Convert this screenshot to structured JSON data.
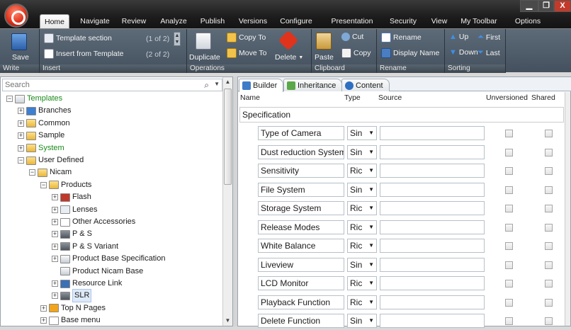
{
  "window": {
    "minimize": "▁",
    "restore": "❐",
    "close": "X"
  },
  "tabs": [
    "Home",
    "Navigate",
    "Review",
    "Analyze",
    "Publish",
    "Versions",
    "Configure",
    "Presentation",
    "Security",
    "View",
    "My Toolbar",
    "Options"
  ],
  "ribbon": {
    "write": {
      "label": "Write",
      "save": "Save"
    },
    "insert": {
      "label": "Insert",
      "template_section": "Template section",
      "template_section_count": "(1 of 2)",
      "insert_from_template": "Insert from Template",
      "insert_from_template_count": "(2 of 2)"
    },
    "operations": {
      "label": "Operations",
      "duplicate": "Duplicate",
      "copy_to": "Copy To",
      "move_to": "Move To",
      "delete": "Delete"
    },
    "clipboard": {
      "label": "Clipboard",
      "paste": "Paste",
      "cut": "Cut",
      "copy": "Copy"
    },
    "rename": {
      "label": "Rename",
      "rename": "Rename",
      "display_name": "Display Name"
    },
    "sorting": {
      "label": "Sorting",
      "up": "Up",
      "down": "Down",
      "first": "First",
      "last": "Last"
    }
  },
  "search": {
    "placeholder": "Search"
  },
  "tree": [
    {
      "label": "Templates",
      "level": 0,
      "exp": "−",
      "icon": "template-icon",
      "green": true
    },
    {
      "label": "Branches",
      "level": 1,
      "exp": "+",
      "icon": "branches-icon"
    },
    {
      "label": "Common",
      "level": 1,
      "exp": "+",
      "icon": "folder-icon"
    },
    {
      "label": "Sample",
      "level": 1,
      "exp": "+",
      "icon": "folder-icon"
    },
    {
      "label": "System",
      "level": 1,
      "exp": "+",
      "icon": "system-folder-icon",
      "green": true
    },
    {
      "label": "User Defined",
      "level": 1,
      "exp": "−",
      "icon": "folder-icon"
    },
    {
      "label": "Nicam",
      "level": 2,
      "exp": "−",
      "icon": "folder-icon"
    },
    {
      "label": "Products",
      "level": 3,
      "exp": "−",
      "icon": "folder-icon"
    },
    {
      "label": "Flash",
      "level": 4,
      "exp": "+",
      "icon": "flash-icon"
    },
    {
      "label": "Lenses",
      "level": 4,
      "exp": "+",
      "icon": "search-icon"
    },
    {
      "label": "Other Accessories",
      "level": 4,
      "exp": "+",
      "icon": "document-icon"
    },
    {
      "label": "P & S",
      "level": 4,
      "exp": "+",
      "icon": "camera-icon"
    },
    {
      "label": "P & S Variant",
      "level": 4,
      "exp": "+",
      "icon": "camera-icon"
    },
    {
      "label": "Product Base Specification",
      "level": 4,
      "exp": "+",
      "icon": "spec-icon"
    },
    {
      "label": "Product Nicam Base",
      "level": 4,
      "exp": "",
      "icon": "spec-icon"
    },
    {
      "label": "Resource Link",
      "level": 4,
      "exp": "+",
      "icon": "link-icon"
    },
    {
      "label": "SLR",
      "level": 4,
      "exp": "+",
      "icon": "camera-icon",
      "selected": true
    },
    {
      "label": "Top N Pages",
      "level": 3,
      "exp": "+",
      "icon": "star-icon"
    },
    {
      "label": "Base menu",
      "level": 3,
      "exp": "+",
      "icon": "document-icon"
    }
  ],
  "right_tabs": [
    "Builder",
    "Inheritance",
    "Content"
  ],
  "columns": {
    "name": "Name",
    "type": "Type",
    "source": "Source",
    "unversioned": "Unversioned",
    "shared": "Shared"
  },
  "section": "Specification",
  "rows": [
    {
      "name": "Type of Camera",
      "type": "Sin"
    },
    {
      "name": "Dust reduction System",
      "type": "Sin"
    },
    {
      "name": "Sensitivity",
      "type": "Ric"
    },
    {
      "name": "File System",
      "type": "Sin"
    },
    {
      "name": "Storage System",
      "type": "Ric"
    },
    {
      "name": "Release Modes",
      "type": "Ric"
    },
    {
      "name": "White Balance",
      "type": "Ric"
    },
    {
      "name": "Liveview",
      "type": "Sin"
    },
    {
      "name": "LCD Monitor",
      "type": "Ric"
    },
    {
      "name": "Playback Function",
      "type": "Ric"
    },
    {
      "name": "Delete Function",
      "type": "Sin"
    }
  ],
  "colors": {
    "accent": "#e0331c",
    "green": "#1a8a1a",
    "ribbon": "#4e5a66"
  }
}
